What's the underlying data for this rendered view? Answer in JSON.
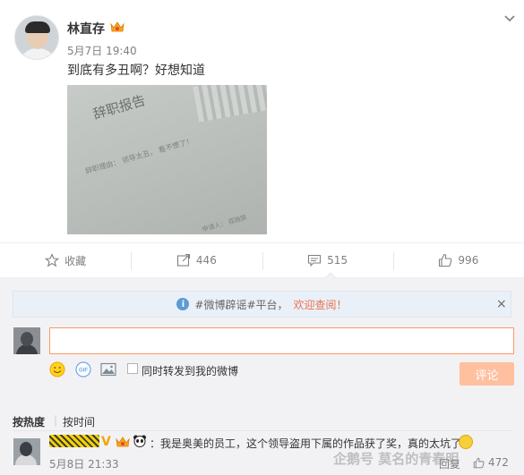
{
  "post": {
    "author": "林直存",
    "time": "5月7日 19:40",
    "text": "到底有多丑啊？好想知道",
    "photo": {
      "title": "辞职报告",
      "line1": "辞职理由： 领导太丑， 看不惯了！",
      "line2": "申请人： 孤独狼"
    }
  },
  "actions": {
    "favorite": "收藏",
    "repost": "446",
    "comment": "515",
    "like": "996"
  },
  "notice": {
    "text": "#微博辟谣#平台，",
    "link": "欢迎查阅！",
    "close": "×",
    "info_icon": "i"
  },
  "composer": {
    "value": "",
    "repost_label": "同时转发到我的微博",
    "submit_label": "评论",
    "gif_label": "GIF"
  },
  "sort": {
    "hot": "按热度",
    "separator": "|",
    "time": "按时间"
  },
  "comment": {
    "verified": "V",
    "text": "：我是奥美的员工，这个领导盗用下属的作品获了奖，真的太坑了",
    "time": "5月8日 21:33",
    "reply": "回复",
    "likes": "472"
  },
  "watermark": "企鹅号 莫名的青春明",
  "colors": {
    "accent": "#eb7350",
    "input_border": "#ff9a5e",
    "submit_bg": "#ffc09f",
    "panel_bg": "#f2f2f5"
  }
}
